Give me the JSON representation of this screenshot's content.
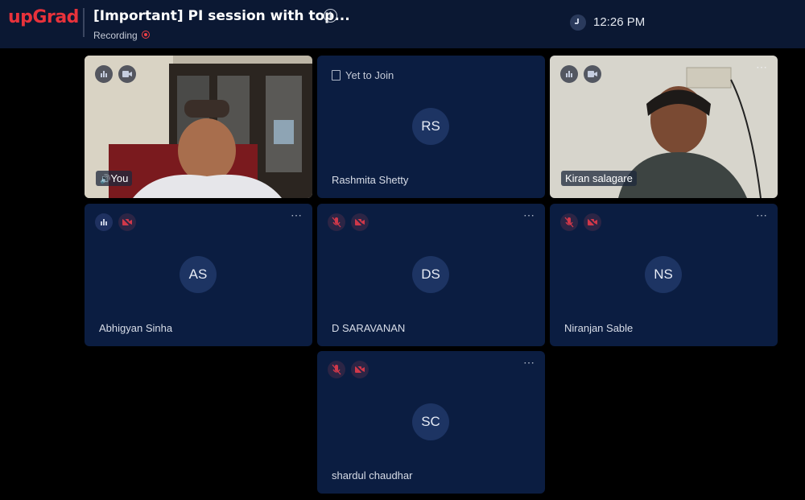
{
  "app": {
    "logo": "upGrad"
  },
  "meeting": {
    "title": "[Important] PI session with top...",
    "status": "Recording",
    "time": "12:26 PM"
  },
  "tiles": [
    {
      "name": "You",
      "type": "video"
    },
    {
      "name": "Rashmita Shetty",
      "initials": "RS",
      "status": "Yet to Join"
    },
    {
      "name": "Kiran salagare",
      "type": "video"
    },
    {
      "name": "Abhigyan Sinha",
      "initials": "AS"
    },
    {
      "name": "D SARAVANAN",
      "initials": "DS"
    },
    {
      "name": "Niranjan Sable",
      "initials": "NS"
    },
    {
      "name": "shardul chaudhar",
      "initials": "SC"
    }
  ],
  "icons": {
    "more": "⋯",
    "info": "i"
  },
  "colors": {
    "brand": "#e8323b",
    "topbar": "#0b1833",
    "tile": "#0b1d41",
    "avatar": "#1d3463",
    "recording": "#ee3f46"
  }
}
